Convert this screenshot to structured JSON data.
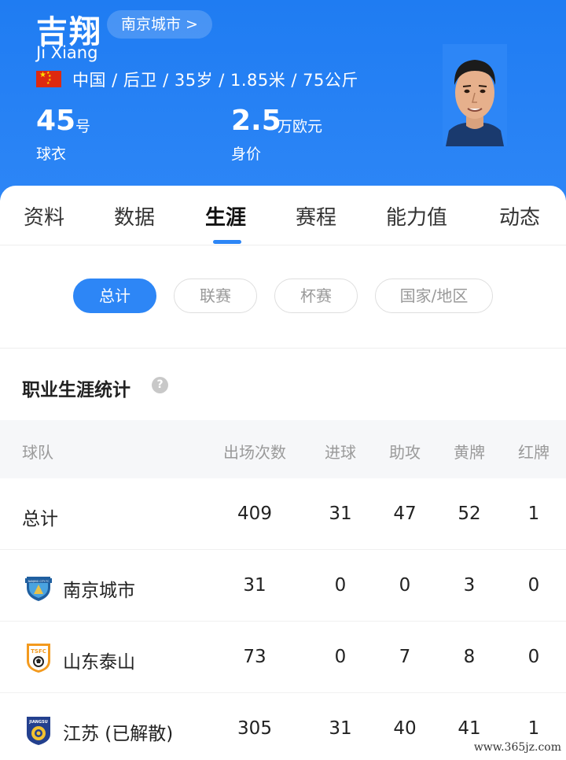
{
  "player": {
    "name": "吉翔",
    "latin_name": "Ji Xiang",
    "club_link": "南京城市 >",
    "info_line": "中国 / 后卫 / 35岁 / 1.85米 / 75公斤",
    "shirt_number": "45",
    "shirt_unit": "号",
    "shirt_label": "球衣",
    "market_value": "2.5",
    "value_unit": "万欧元",
    "value_label": "身价",
    "flag_colors": {
      "red": "#de2910",
      "yellow": "#ffde00"
    }
  },
  "tabs": [
    "资料",
    "数据",
    "生涯",
    "赛程",
    "能力值",
    "动态"
  ],
  "active_tab": "生涯",
  "filters": [
    "总计",
    "联赛",
    "杯赛",
    "国家/地区"
  ],
  "active_filter": "总计",
  "section_title": "职业生涯统计",
  "table": {
    "headers": [
      "球队",
      "出场次数",
      "进球",
      "助攻",
      "黄牌",
      "红牌"
    ],
    "rows": [
      {
        "team": "总计",
        "apps": "409",
        "goals": "31",
        "assists": "47",
        "yellow": "52",
        "red": "1"
      },
      {
        "team": "南京城市",
        "apps": "31",
        "goals": "0",
        "assists": "0",
        "yellow": "3",
        "red": "0"
      },
      {
        "team": "山东泰山",
        "apps": "73",
        "goals": "0",
        "assists": "7",
        "yellow": "8",
        "red": "0"
      },
      {
        "team": "江苏 (已解散)",
        "apps": "305",
        "goals": "31",
        "assists": "40",
        "yellow": "41",
        "red": "1"
      }
    ]
  },
  "logos": {
    "nanjing_text": "NANJING CITY FC",
    "shandong_text": "TSFC",
    "jiangsu_text": "JIANGSU"
  },
  "watermark": "www.365jz.com",
  "colors": {
    "primary": "#2d86f6",
    "header_bg": "#1f7cf2"
  }
}
